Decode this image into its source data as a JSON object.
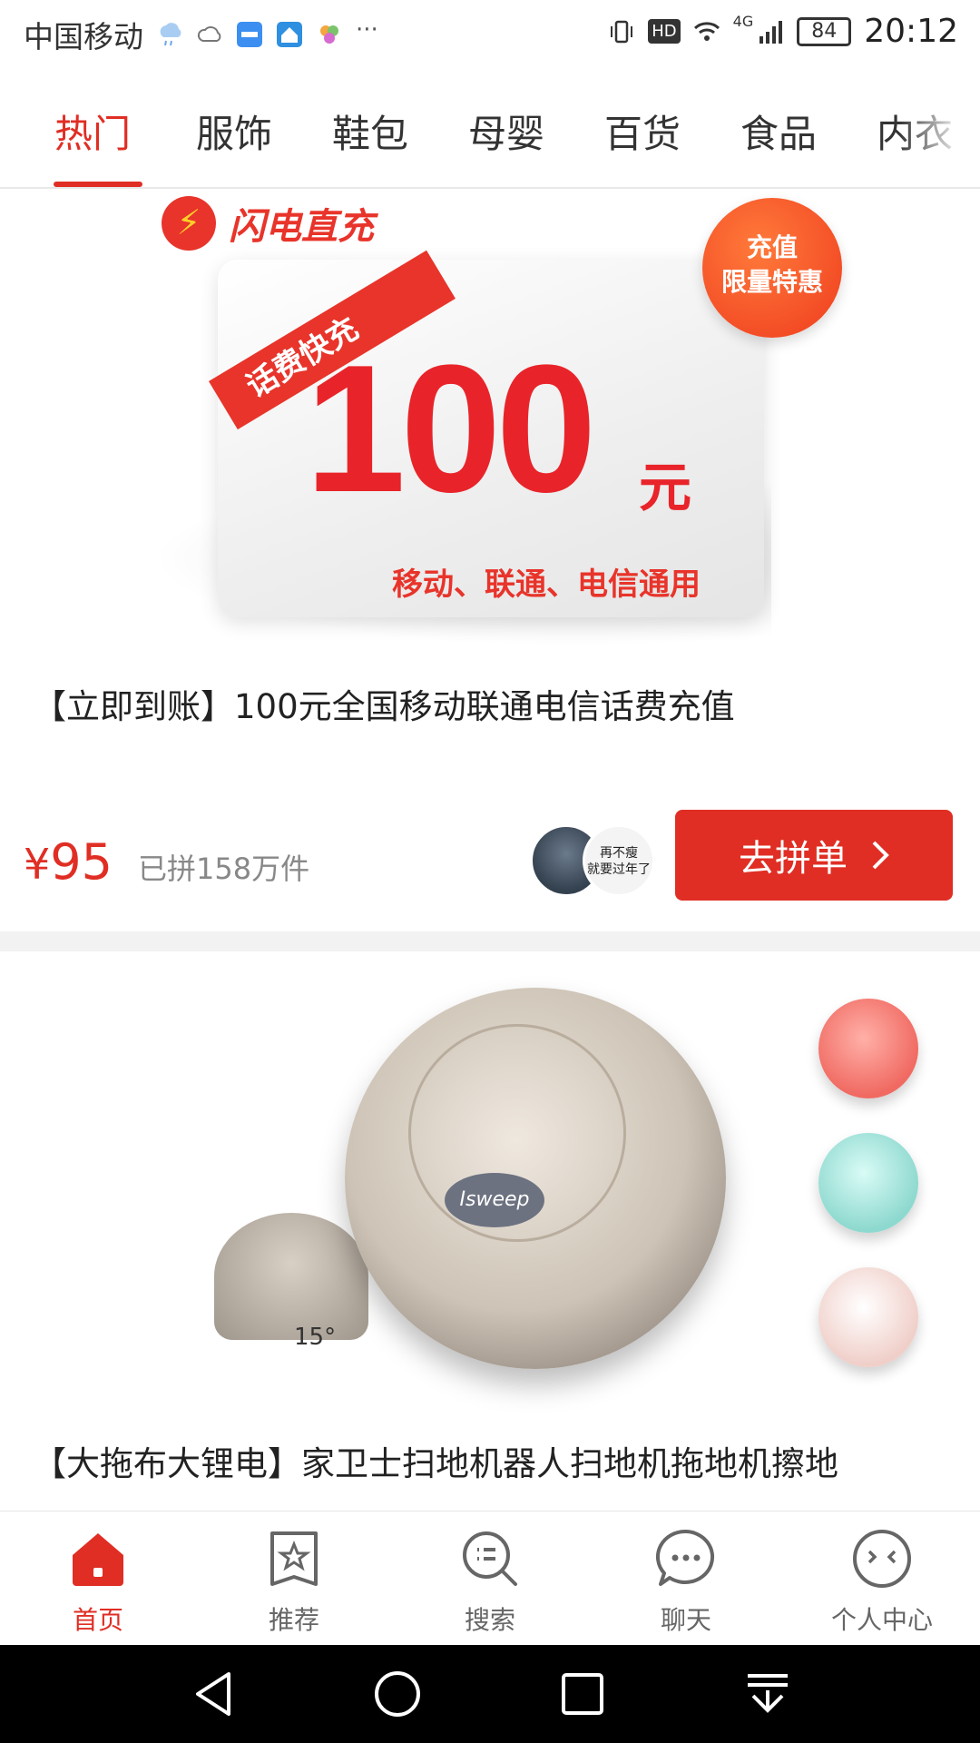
{
  "status_bar": {
    "carrier": "中国移动",
    "time": "20:12",
    "battery": "84",
    "network": "4G",
    "hd": "HD"
  },
  "tabs": [
    {
      "label": "热门",
      "active": true
    },
    {
      "label": "服饰"
    },
    {
      "label": "鞋包"
    },
    {
      "label": "母婴"
    },
    {
      "label": "百货"
    },
    {
      "label": "食品"
    },
    {
      "label": "内衣"
    }
  ],
  "products": [
    {
      "title": "【立即到账】100元全国移动联通电信话费充值",
      "price_symbol": "¥",
      "price": "95",
      "sold": "已拼158万件",
      "button": "去拼单",
      "image": {
        "brand": "闪电直充",
        "ribbon": "话费快充",
        "amount": "100",
        "unit": "元",
        "carriers": "移动、联通、电信通用",
        "promo_line1": "充值",
        "promo_line2": "限量特惠"
      },
      "avatar_text_line1": "再不瘦",
      "avatar_text_line2": "就要过年了"
    },
    {
      "title": "【大拖布大锂电】家卫士扫地机器人扫地机拖地机擦地",
      "image": {
        "logo": "Isweep",
        "angle": "15°"
      }
    }
  ],
  "bottom_nav": [
    {
      "label": "首页",
      "icon": "home-icon",
      "active": true
    },
    {
      "label": "推荐",
      "icon": "star-bookmark-icon"
    },
    {
      "label": "搜索",
      "icon": "search-icon"
    },
    {
      "label": "聊天",
      "icon": "chat-icon"
    },
    {
      "label": "个人中心",
      "icon": "profile-icon"
    }
  ],
  "colors": {
    "accent": "#e02e24",
    "divider": "#f2f2f2"
  }
}
